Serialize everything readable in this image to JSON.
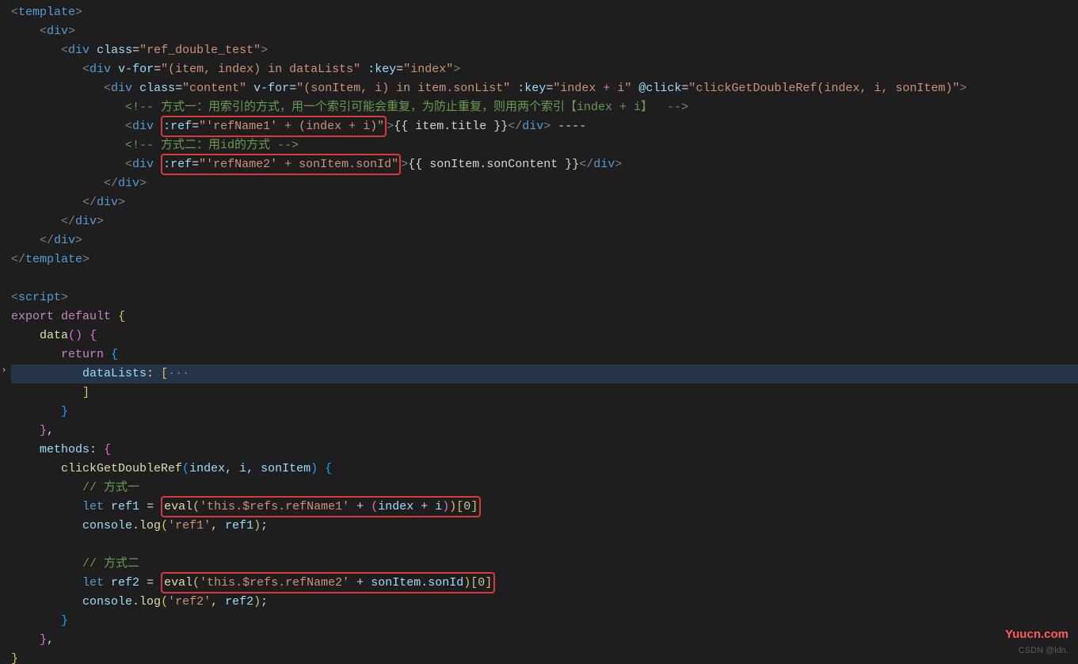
{
  "code": {
    "l1": {
      "tag": "template"
    },
    "l2": {
      "tag": "div"
    },
    "l3": {
      "tag": "div",
      "cls": "ref_double_test"
    },
    "l4": {
      "tag": "div",
      "vfor": "(item, index) in dataLists",
      "key": "index"
    },
    "l5": {
      "tag": "div",
      "cls": "content",
      "vfor": "(sonItem, i) in item.sonList",
      "key": "index + i",
      "click": "clickGetDoubleRef(index, i, sonItem)"
    },
    "l6": {
      "cmt": "方式一：用索引的方式，用一个索引可能会重复，为防止重复，则用两个索引【index + i】 "
    },
    "l7": {
      "tag": "div",
      "ref": "'refName1' + (index + i)",
      "bind": "{{ item.title }}",
      "tail": " ----"
    },
    "l8": {
      "cmt": "方式二：用id的方式"
    },
    "l9": {
      "tag": "div",
      "ref": "'refName2' + sonItem.sonId",
      "bind": "{{ sonItem.sonContent }}"
    },
    "l10": {
      "close": "div"
    },
    "l11": {
      "close": "div"
    },
    "l12": {
      "close": "div"
    },
    "l13": {
      "close": "div"
    },
    "l14": {
      "close": "template"
    },
    "l15": {
      "tag": "script"
    },
    "l16": {
      "a": "export",
      "b": "default"
    },
    "l17": {
      "fn": "data"
    },
    "l18": {
      "kw": "return"
    },
    "l19": {
      "prop": "dataLists",
      "ell": "···"
    },
    "l20": {
      "prop": "methods"
    },
    "l21": {
      "fn": "clickGetDoubleRef",
      "args": "index, i, sonItem"
    },
    "l22": {
      "cmt": "// 方式一"
    },
    "l23": {
      "v": "ref1",
      "eval": "eval",
      "s": "'this.$refs.refName1'",
      "rest": " + (index + i))[0]"
    },
    "l24": {
      "log": "console",
      "m": "log",
      "s": "'ref1'",
      "v": "ref1"
    },
    "l25": {
      "cmt": "// 方式二"
    },
    "l26": {
      "v": "ref2",
      "eval": "eval",
      "s": "'this.$refs.refName2'",
      "rest": " + sonItem.sonId)[0]"
    },
    "l27": {
      "log": "console",
      "m": "log",
      "s": "'ref2'",
      "v": "ref2"
    }
  },
  "water1": "Yuucn.com",
  "water2": "CSDN @ldn."
}
